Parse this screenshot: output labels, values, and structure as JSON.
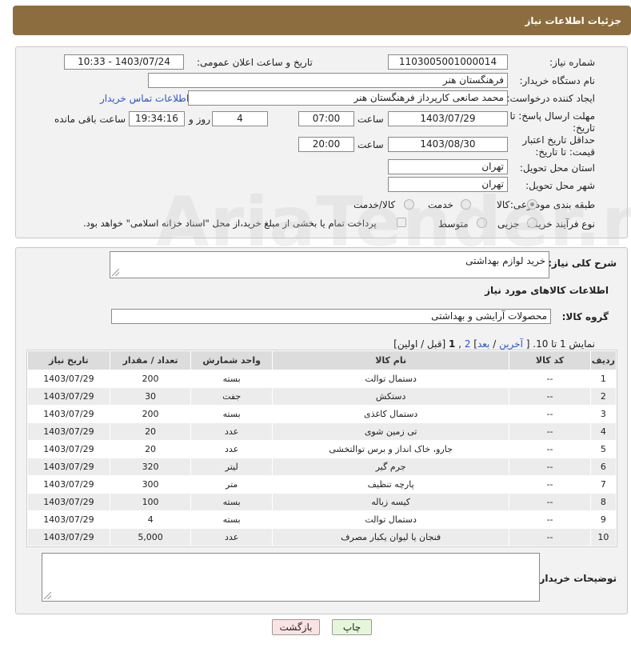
{
  "header": {
    "title": "جزئیات اطلاعات نیاز"
  },
  "form": {
    "need_number_label": "شماره نیاز:",
    "need_number": "1103005001000014",
    "announce_label": "تاریخ و ساعت اعلان عمومی:",
    "announce_value": "1403/07/24 - 10:33",
    "buyer_org_label": "نام دستگاه خریدار:",
    "buyer_org": "فرهنگستان هنر",
    "requester_label": "ایجاد کننده درخواست:",
    "requester": "محمد صانعی کارپرداز فرهنگستان هنر",
    "contact_link": "اطلاعات تماس خریدار",
    "deadline_label": "مهلت ارسال پاسخ: تا تاریخ:",
    "deadline_date": "1403/07/29",
    "time_label": "ساعت",
    "deadline_time": "07:00",
    "days_value": "4",
    "days_label": "روز و",
    "remaining_time": "19:34:16",
    "remaining_label": "ساعت باقی مانده",
    "validity_label": "حداقل تاریخ اعتبار قیمت: تا تاریخ:",
    "validity_date": "1403/08/30",
    "validity_time": "20:00",
    "province_label": "استان محل تحویل:",
    "province": "تهران",
    "city_label": "شهر محل تحویل:",
    "city": "تهران",
    "category_label": "طبقه بندی موضوعی:",
    "category_options": [
      "کالا",
      "خدمت",
      "کالا/خدمت"
    ],
    "process_label": "نوع فرآیند خرید :",
    "process_options": [
      "جزیی",
      "متوسط"
    ],
    "payment_note": "پرداخت تمام یا بخشی از مبلغ خرید،از محل \"اسناد خزانه اسلامی\" خواهد بود."
  },
  "summary": {
    "label": "شرح کلی نیاز:",
    "value": "خرید لوازم بهداشتی"
  },
  "goods": {
    "section_title": "اطلاعات کالاهای مورد نیاز",
    "group_label": "گروه کالا:",
    "group_value": "محصولات آرایشی و بهداشتی",
    "pager": {
      "show_text": "نمایش 1 تا 10. [",
      "last": "آخرین",
      "sep1": " / ",
      "next": "بعد",
      "page2": "2",
      "comma": " ,",
      "page1": "1",
      "tail": " [قبل / اولین]"
    },
    "columns": [
      "ردیف",
      "کد کالا",
      "نام کالا",
      "واحد شمارش",
      "تعداد / مقدار",
      "تاریخ نیاز"
    ],
    "rows": [
      [
        "1",
        "--",
        "دستمال توالت",
        "بسته",
        "200",
        "1403/07/29"
      ],
      [
        "2",
        "--",
        "دستکش",
        "جفت",
        "30",
        "1403/07/29"
      ],
      [
        "3",
        "--",
        "دستمال کاغذی",
        "بسته",
        "200",
        "1403/07/29"
      ],
      [
        "4",
        "--",
        "تی زمین شوی",
        "عدد",
        "20",
        "1403/07/29"
      ],
      [
        "5",
        "--",
        "جارو، خاک انداز و برس توالتخشی",
        "عدد",
        "20",
        "1403/07/29"
      ],
      [
        "6",
        "--",
        "جرم گیر",
        "لیتر",
        "320",
        "1403/07/29"
      ],
      [
        "7",
        "--",
        "پارچه تنظیف",
        "متر",
        "300",
        "1403/07/29"
      ],
      [
        "8",
        "--",
        "کیسه زباله",
        "بسته",
        "100",
        "1403/07/29"
      ],
      [
        "9",
        "--",
        "دستمال توالت",
        "بسته",
        "4",
        "1403/07/29"
      ],
      [
        "10",
        "--",
        "فنجان یا لیوان یکبار مصرف",
        "عدد",
        "5,000",
        "1403/07/29"
      ]
    ]
  },
  "notes": {
    "label": "توضیحات خریدار:",
    "value": ""
  },
  "buttons": {
    "print": "چاپ",
    "back": "بازگشت"
  },
  "watermark": "AriaTender.neT",
  "colors": {
    "header": "#8c6d3f",
    "link": "#2b54c7",
    "print_btn": "#e6f7d9",
    "back_btn": "#fbe3e3"
  }
}
